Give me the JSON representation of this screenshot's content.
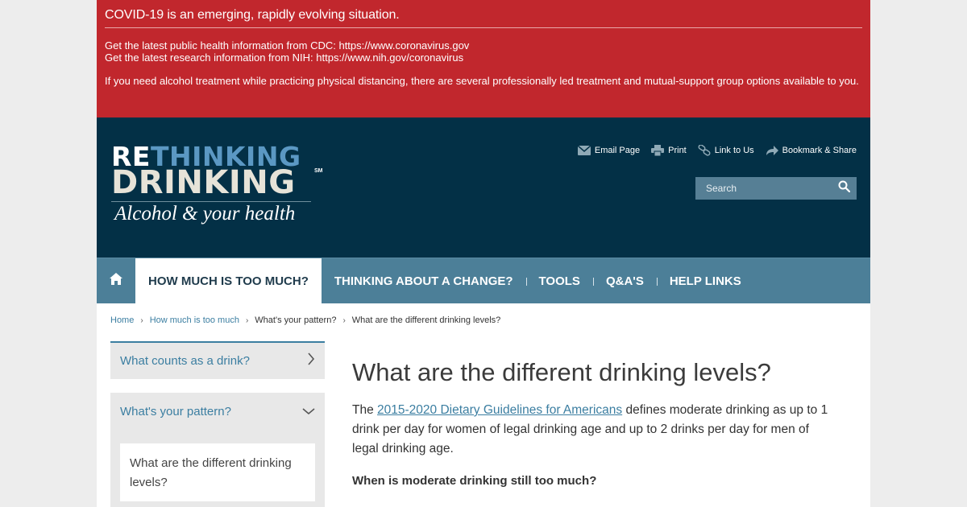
{
  "alert": {
    "title": "COVID-19 is an emerging, rapidly evolving situation.",
    "cdc": "Get the latest public health information from CDC: https://www.coronavirus.gov",
    "nih": "Get the latest research information from NIH: https://www.nih.gov/coronavirus",
    "note": "If you need alcohol treatment while practicing physical distancing, there are several professionally led treatment and mutual-support group options available to you."
  },
  "logo": {
    "re": "RE",
    "thinking": "THINKING",
    "drinking": "DRINKING",
    "sm": "SM",
    "tagline": "Alcohol & your health"
  },
  "utility": {
    "email": "Email Page",
    "print": "Print",
    "link": "Link to Us",
    "bookmark": "Bookmark & Share"
  },
  "search": {
    "placeholder": "Search"
  },
  "nav": {
    "items": [
      {
        "label": "HOW MUCH IS TOO MUCH?"
      },
      {
        "label": "THINKING ABOUT A CHANGE?"
      },
      {
        "label": "TOOLS"
      },
      {
        "label": "Q&A'S"
      },
      {
        "label": "HELP LINKS"
      }
    ]
  },
  "breadcrumb": {
    "items": [
      "Home",
      "How much is too much",
      "What's your pattern?",
      "What are the different drinking levels?"
    ]
  },
  "sidebar": {
    "item1": "What counts as a drink?",
    "item2": "What's your pattern?",
    "sub1": "What are the different drinking levels?"
  },
  "main": {
    "title": "What are the different drinking levels?",
    "p_start": "The ",
    "p_link": "2015-2020 Dietary Guidelines for Americans",
    "p_end": " defines moderate drinking as up to 1 drink per day for women of legal drinking age and up to 2 drinks per day for men of legal drinking age.",
    "question": "When is moderate drinking still too much?"
  },
  "colors": {
    "alert": "#c1272d",
    "header": "#033046",
    "nav": "#4c7f98",
    "link": "#3b7ea1"
  }
}
